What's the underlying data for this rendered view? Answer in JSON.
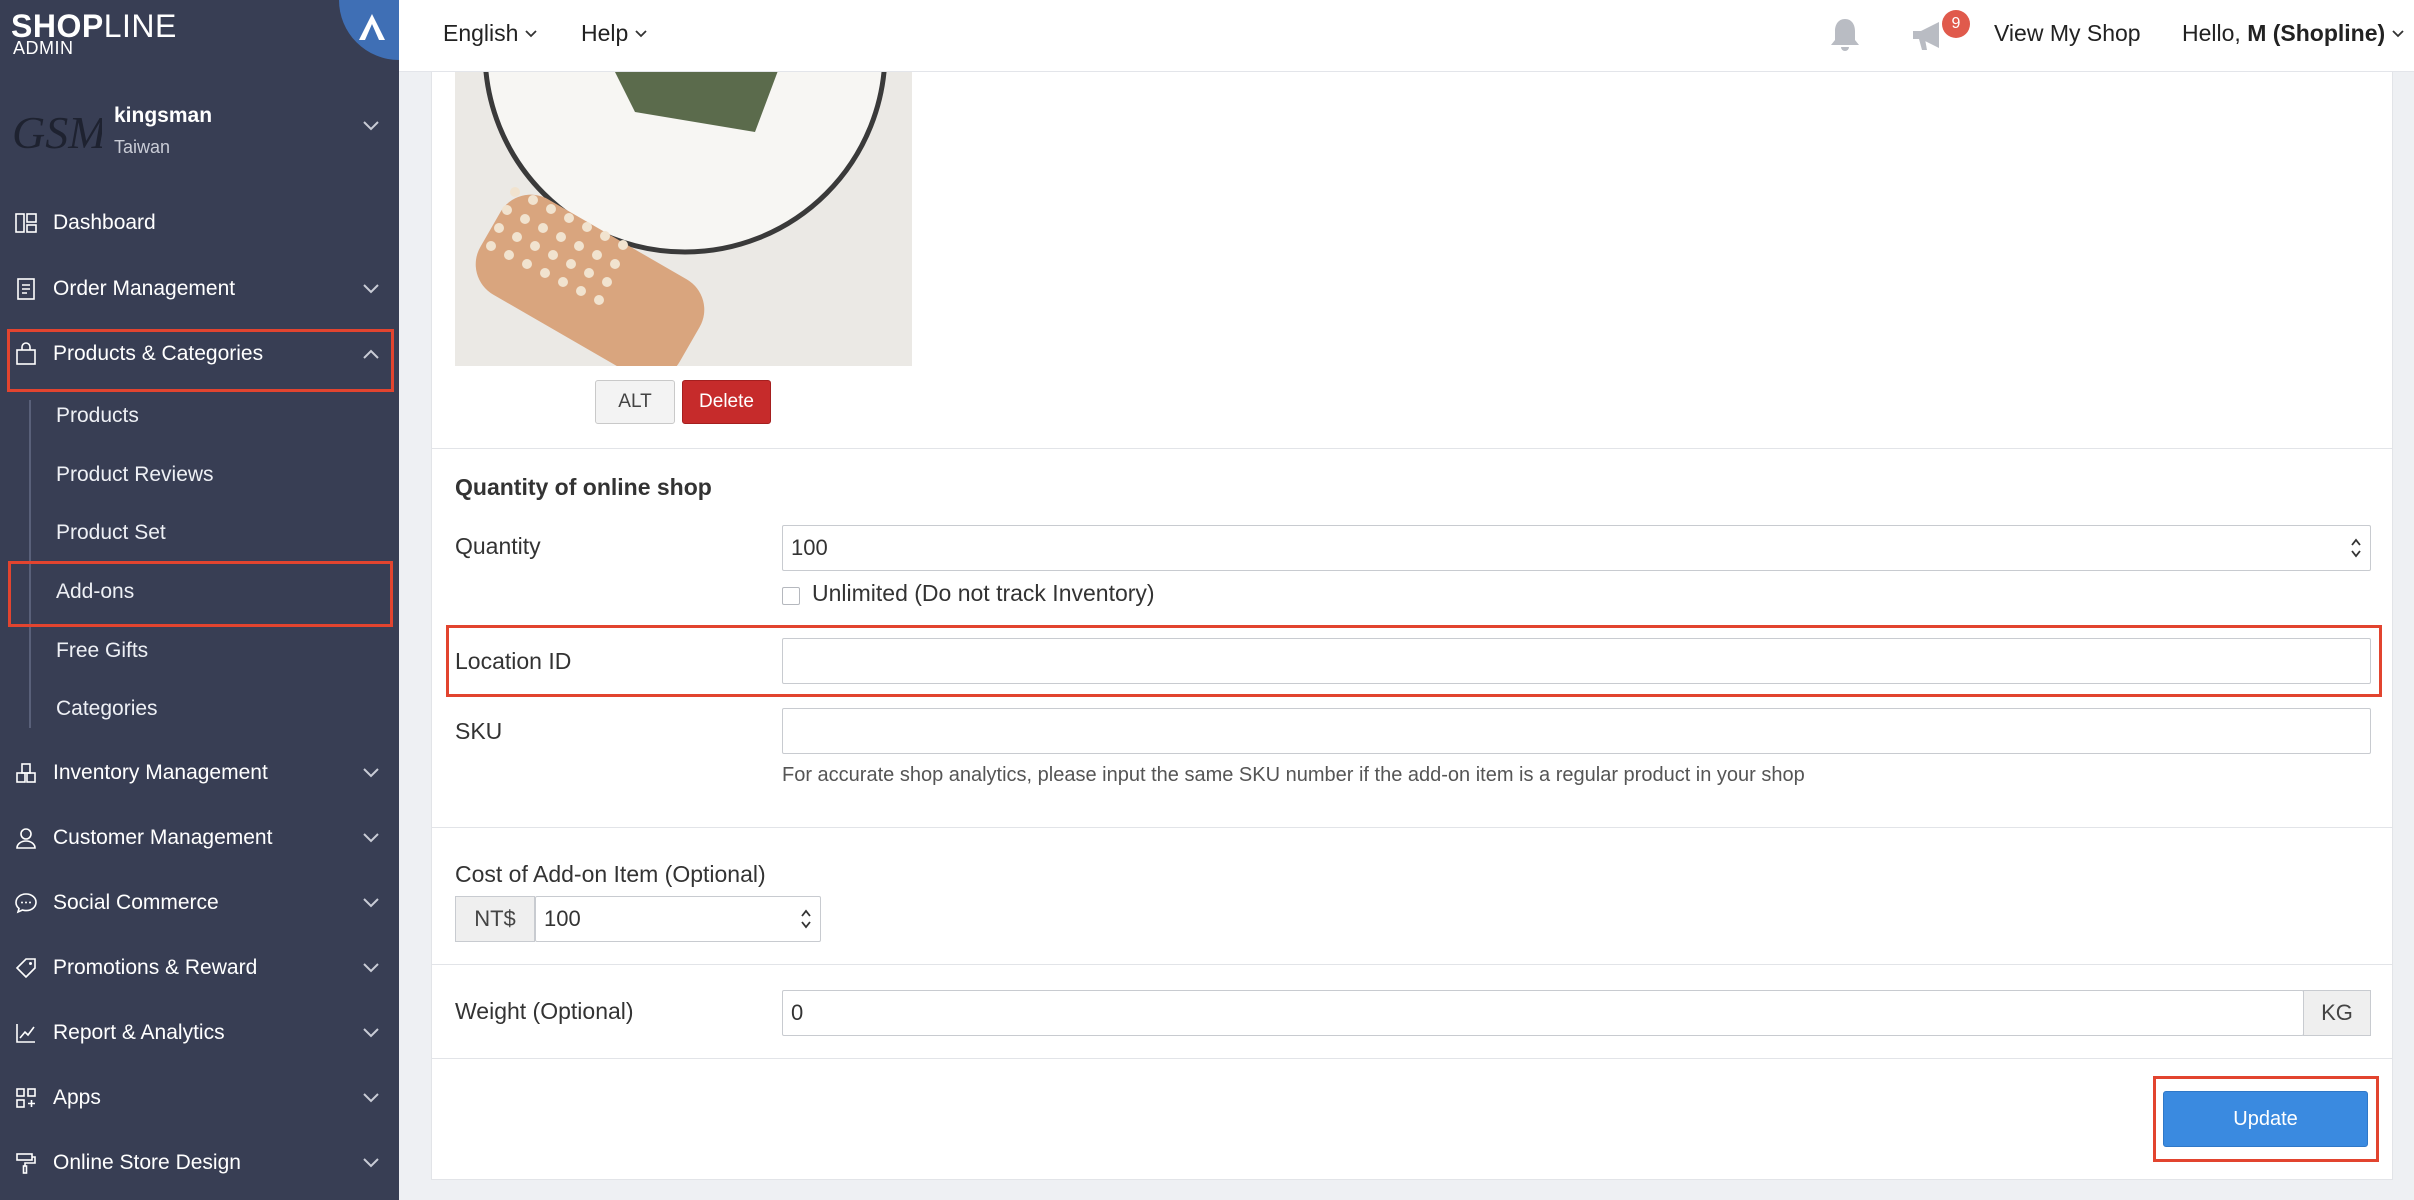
{
  "brand": {
    "logo_main": "SHOP",
    "logo_thin": "LINE",
    "logo_sub": "ADMIN",
    "accent_color": "#3f6fb5"
  },
  "shop": {
    "avatar_text": "GSM",
    "name": "kingsman",
    "country": "Taiwan"
  },
  "sidebar": {
    "items": [
      {
        "label": "Dashboard",
        "icon": "dashboard-icon"
      },
      {
        "label": "Order Management",
        "icon": "order-icon"
      },
      {
        "label": "Products & Categories",
        "icon": "shopping-bag-icon"
      },
      {
        "label": "Inventory Management",
        "icon": "warehouse-icon"
      },
      {
        "label": "Customer Management",
        "icon": "user-icon"
      },
      {
        "label": "Social Commerce",
        "icon": "chat-bubble-icon"
      },
      {
        "label": "Promotions & Reward",
        "icon": "tag-icon"
      },
      {
        "label": "Report & Analytics",
        "icon": "chart-icon"
      },
      {
        "label": "Apps",
        "icon": "apps-grid-icon"
      },
      {
        "label": "Online Store Design",
        "icon": "paint-roller-icon"
      }
    ],
    "sub_items": [
      "Products",
      "Product Reviews",
      "Product Set",
      "Add-ons",
      "Free Gifts",
      "Categories"
    ]
  },
  "topbar": {
    "language": "English",
    "help": "Help",
    "notification_count": "9",
    "view_shop": "View My Shop",
    "greeting_prefix": "Hello, ",
    "greeting_user": "M (Shopline)"
  },
  "form": {
    "alt_label": "ALT",
    "delete_label": "Delete",
    "online_section_title": "Quantity of online shop",
    "quantity_label": "Quantity",
    "quantity_value": "100",
    "unlimited_label": "Unlimited (Do not track Inventory)",
    "location_label": "Location ID",
    "location_value": "",
    "sku_label": "SKU",
    "sku_value": "",
    "sku_help": "For accurate shop analytics, please input the same SKU number if the add-on item is a regular product in your shop",
    "cost_label": "Cost of Add-on Item (Optional)",
    "currency": "NT$",
    "cost_value": "100",
    "weight_label": "Weight (Optional)",
    "weight_value": "0",
    "weight_unit": "KG",
    "update_label": "Update"
  },
  "colors": {
    "sidebar_bg": "#383e54",
    "highlight": "#e2442f",
    "delete": "#c62b2b",
    "update": "#3a8ae0",
    "badge": "#e05a4c"
  }
}
